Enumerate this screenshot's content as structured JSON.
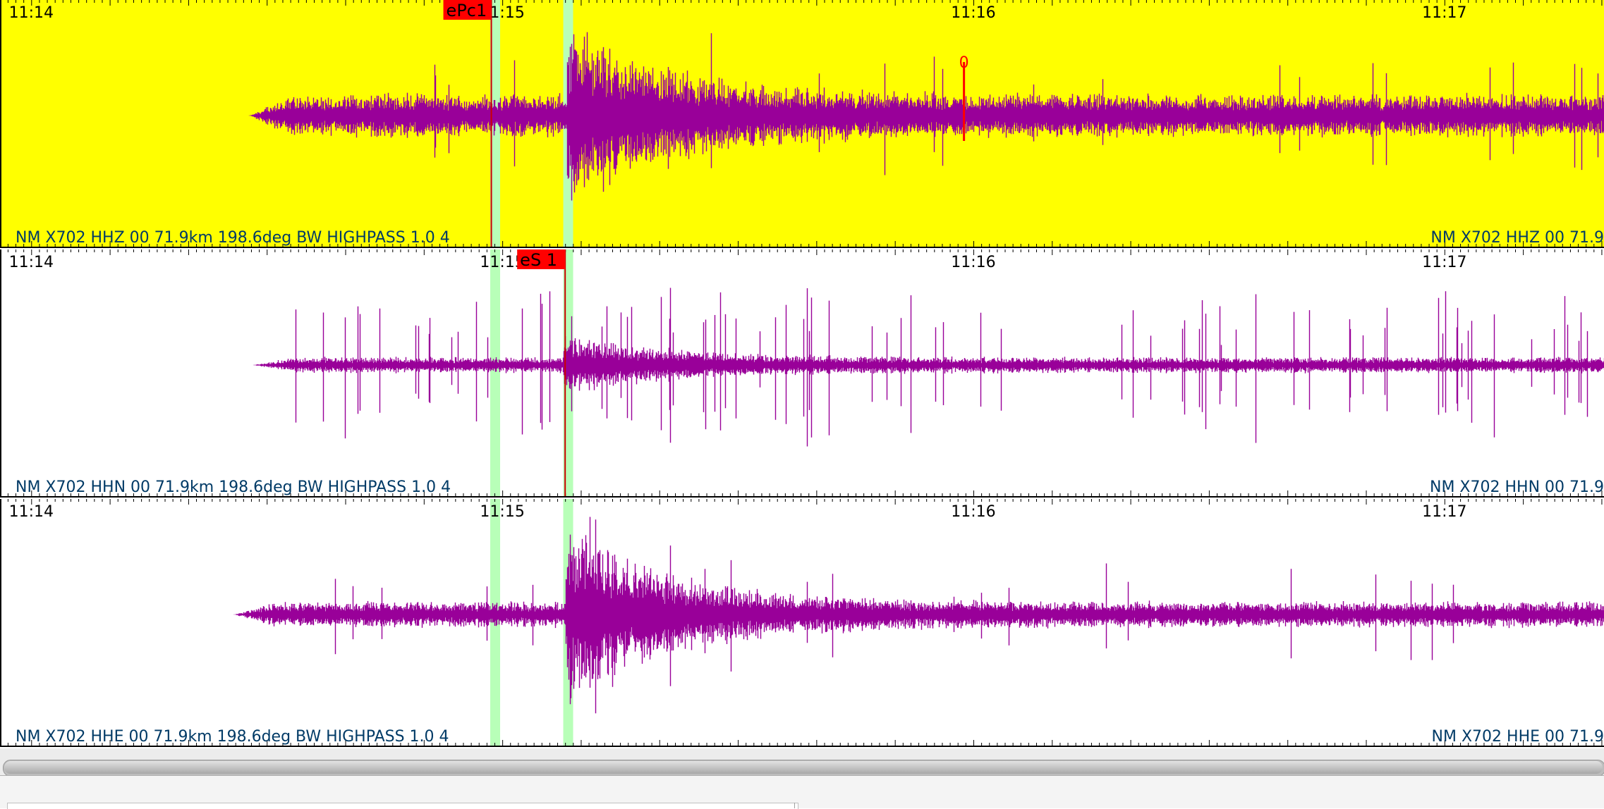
{
  "time_ticks": [
    "11:14",
    "11:15",
    "11:16",
    "11:17"
  ],
  "tick_seconds": [
    0,
    60,
    120,
    180
  ],
  "view_window_seconds": [
    -3.8,
    200.5
  ],
  "colors": {
    "waveform": "#990099",
    "selected_trace_bg": "#ffff00",
    "trace_bg": "#ffffff",
    "pick_flag": "#ff0000",
    "pick_line": "#cc0000",
    "predicted_phase": "#b8ffb8"
  },
  "predicted_phase_markers_seconds": [
    59.0,
    68.3
  ],
  "traces": [
    {
      "id": "hhz",
      "selected": true,
      "label_left": "NM X702 HHZ 00 71.9km 198.6deg BW HIGHPASS 1.0 4",
      "label_right": "NM X702 HHZ 00 71.9",
      "data_start_seconds": 27.8,
      "event_seconds": 68.5,
      "noise_level": 0.22,
      "peak_level": 0.95,
      "spikes": 0.35,
      "picks": [
        {
          "label": "ePc1",
          "time_seconds": 58.6,
          "flag_side": "left",
          "polarity": ""
        }
      ],
      "amplitude_marker": {
        "label": "0",
        "time_seconds": 118.8
      }
    },
    {
      "id": "hhn",
      "selected": false,
      "label_left": "NM X702 HHN 00 71.9km 198.6deg BW HIGHPASS 1.0 4",
      "label_right": "NM X702 HHN 00 71.9",
      "data_start_seconds": 28.2,
      "event_seconds": 68.0,
      "noise_level": 0.08,
      "peak_level": 0.32,
      "spikes": 0.9,
      "picks": [
        {
          "label": "eS 1",
          "time_seconds": 68.0,
          "flag_side": "left",
          "polarity": ""
        }
      ],
      "amplitude_marker": null
    },
    {
      "id": "hhe",
      "selected": false,
      "label_left": "NM X702 HHE 00 71.9km 198.6deg BW HIGHPASS 1.0 4",
      "label_right": "NM X702 HHE 00 71.9",
      "data_start_seconds": 25.8,
      "event_seconds": 68.3,
      "noise_level": 0.13,
      "peak_level": 0.92,
      "spikes": 0.25,
      "picks": [],
      "amplitude_marker": null
    }
  ]
}
